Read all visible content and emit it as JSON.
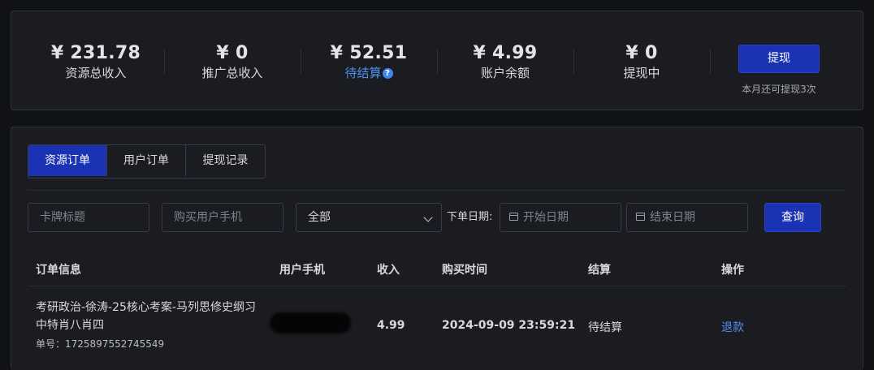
{
  "stats": [
    {
      "amount": "¥ 231.78",
      "label": "资源总收入"
    },
    {
      "amount": "¥ 0",
      "label": "推广总收入"
    },
    {
      "amount": "¥ 52.51",
      "label": "待结算"
    },
    {
      "amount": "¥ 4.99",
      "label": "账户余额"
    },
    {
      "amount": "¥ 0",
      "label": "提现中"
    }
  ],
  "withdraw": {
    "button": "提现",
    "note": "本月还可提现3次"
  },
  "tabs": [
    {
      "label": "资源订单",
      "active": true
    },
    {
      "label": "用户订单",
      "active": false
    },
    {
      "label": "提现记录",
      "active": false
    }
  ],
  "filters": {
    "card_title_placeholder": "卡牌标题",
    "phone_placeholder": "购买用户手机",
    "status_value": "全部",
    "date_label": "下单日期:",
    "start_placeholder": "开始日期",
    "end_placeholder": "结束日期",
    "query_button": "查询"
  },
  "table": {
    "headers": [
      "订单信息",
      "用户手机",
      "收入",
      "购买时间",
      "结算",
      "操作"
    ],
    "rows": [
      {
        "title_line1": "考研政治-徐涛-25核心考案-马列思修史纲习",
        "title_line2": "中特肖八肖四",
        "order_no": "单号：1725897552745549",
        "phone": "",
        "income": "4.99",
        "time": "2024-09-09 23:59:21",
        "settlement": "待结算",
        "action": "退款"
      }
    ]
  },
  "colors": {
    "accent": "#1a32b4",
    "link": "#4f8ff0",
    "background": "#111214",
    "panel": "#1b1c21"
  }
}
